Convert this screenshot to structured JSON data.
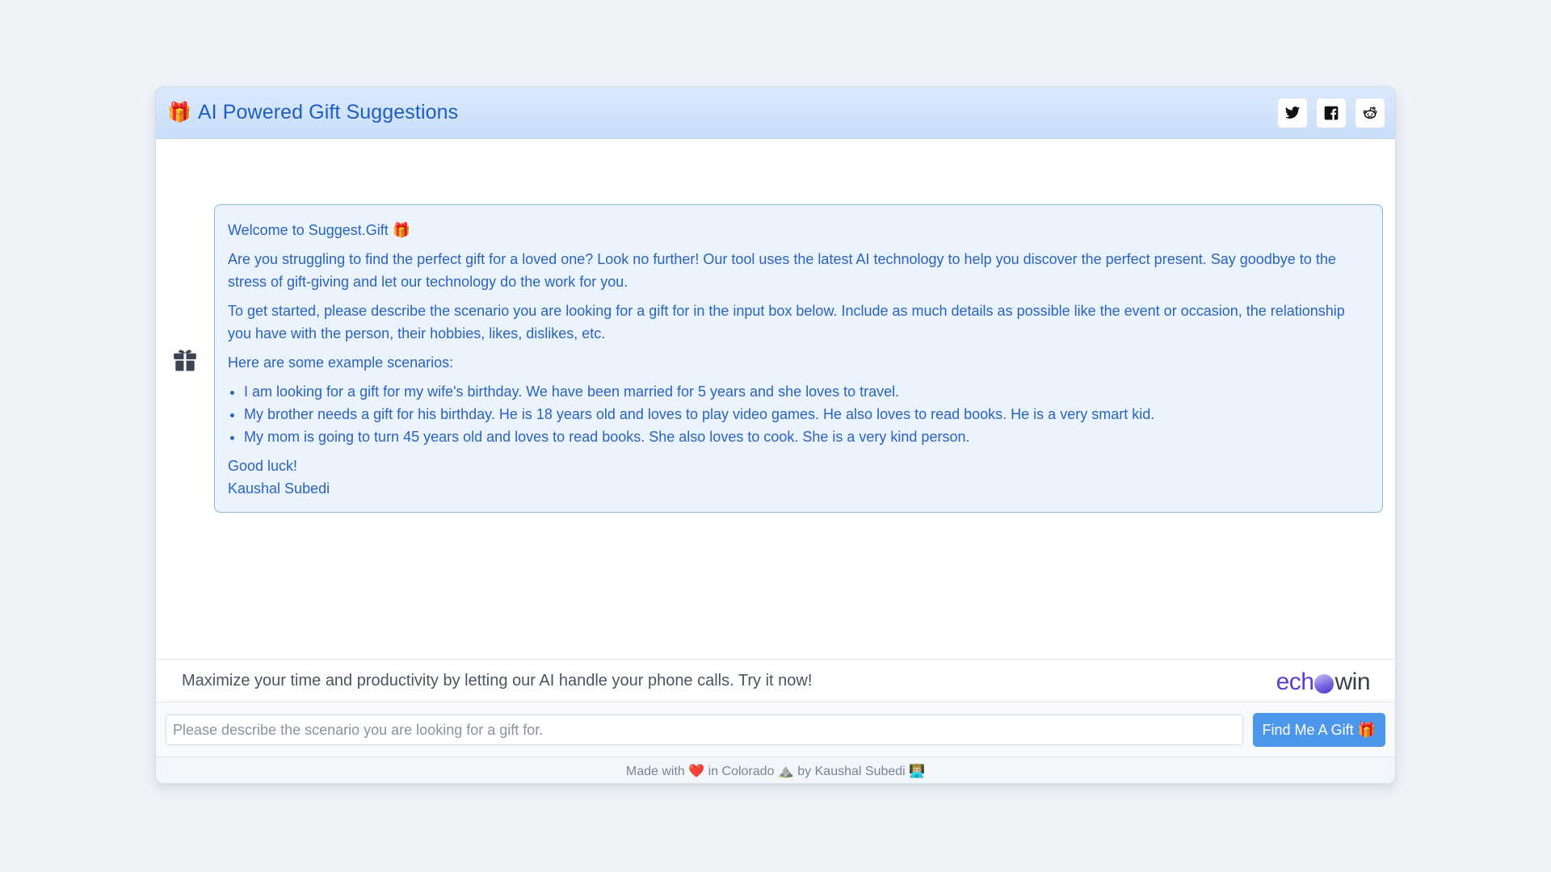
{
  "header": {
    "title_emoji": "🎁",
    "title": "AI Powered Gift Suggestions",
    "socials": [
      {
        "name": "twitter-icon"
      },
      {
        "name": "facebook-icon"
      },
      {
        "name": "reddit-icon"
      }
    ]
  },
  "chat": {
    "avatar_icon": "gift-icon",
    "message": {
      "welcome": "Welcome to Suggest.Gift 🎁",
      "para1": "Are you struggling to find the perfect gift for a loved one? Look no further! Our tool uses the latest AI technology to help you discover the perfect present. Say goodbye to the stress of gift-giving and let our technology do the work for you.",
      "para2": "To get started, please describe the scenario you are looking for a gift for in the input box below. Include as much details as possible like the event or occasion, the relationship you have with the person, their hobbies, likes, dislikes, etc.",
      "examples_intro": "Here are some example scenarios:",
      "examples": [
        "I am looking for a gift for my wife's birthday. We have been married for 5 years and she loves to travel.",
        "My brother needs a gift for his birthday. He is 18 years old and loves to play video games. He also loves to read books. He is a very smart kid.",
        "My mom is going to turn 45 years old and loves to read books. She also loves to cook. She is a very kind person."
      ],
      "closing": "Good luck!",
      "signature": "Kaushal Subedi"
    }
  },
  "promo": {
    "text": "Maximize your time and productivity by letting our AI handle your phone calls. Try it now!",
    "logo_prefix": "ech",
    "logo_suffix": "win"
  },
  "input": {
    "placeholder": "Please describe the scenario you are looking for a gift for.",
    "value": "",
    "button_label": "Find Me A Gift 🎁"
  },
  "footer": {
    "text": "Made with ❤️ in Colorado ⛰️ by Kaushal Subedi 👨🏼‍💻"
  },
  "colors": {
    "accent": "#1f5fc4",
    "button": "#4c97ec",
    "bubble_bg": "#ebf3fe",
    "bubble_border": "#8db5ec",
    "brand_purple": "#5a3fd1"
  }
}
